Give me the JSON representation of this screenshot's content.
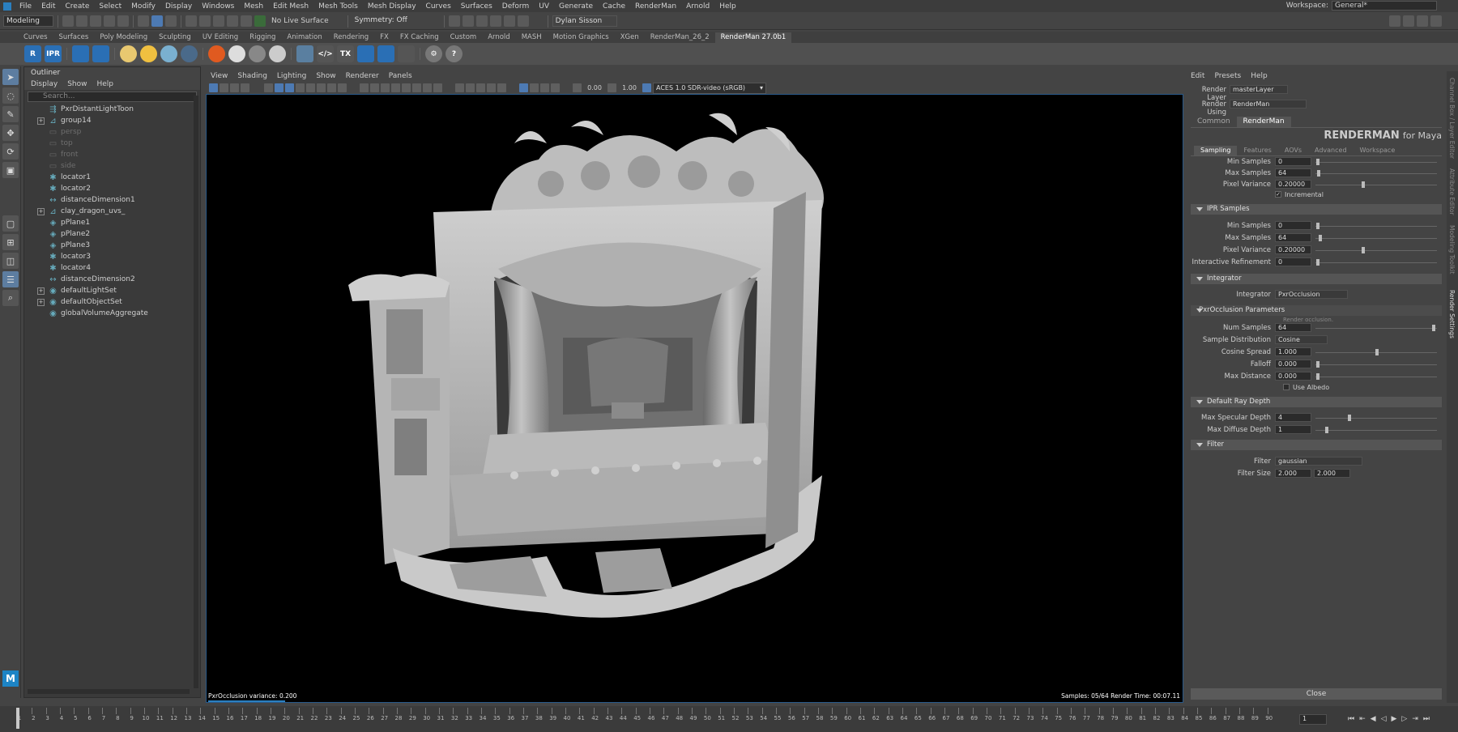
{
  "menubar": {
    "items": [
      "File",
      "Edit",
      "Create",
      "Select",
      "Modify",
      "Display",
      "Windows",
      "Mesh",
      "Edit Mesh",
      "Mesh Tools",
      "Mesh Display",
      "Curves",
      "Surfaces",
      "Deform",
      "UV",
      "Generate",
      "Cache",
      "RenderMan",
      "Arnold",
      "Help"
    ],
    "workspace_label": "Workspace:",
    "workspace_value": "General*"
  },
  "statusline": {
    "mode": "Modeling",
    "live_surface": "No Live Surface",
    "symmetry": "Symmetry: Off",
    "user": "Dylan Sisson"
  },
  "shelf_tabs": [
    "Curves",
    "Surfaces",
    "Poly Modeling",
    "Sculpting",
    "UV Editing",
    "Rigging",
    "Animation",
    "Rendering",
    "FX",
    "FX Caching",
    "Custom",
    "Arnold",
    "MASH",
    "Motion Graphics",
    "XGen",
    "RenderMan_26_2",
    "RenderMan 27.0b1"
  ],
  "shelf_active_tab": "RenderMan 27.0b1",
  "shelf_icons": [
    "R",
    "IPR",
    "TX"
  ],
  "outliner": {
    "title": "Outliner",
    "menu": [
      "Display",
      "Show",
      "Help"
    ],
    "search_placeholder": "Search...",
    "items": [
      {
        "label": "PxrDistantLightToon",
        "icon": "light-icon",
        "expand": false,
        "dim": false
      },
      {
        "label": "group14",
        "icon": "group-icon",
        "expand": true,
        "dim": false
      },
      {
        "label": "persp",
        "icon": "camera-icon",
        "expand": false,
        "dim": true
      },
      {
        "label": "top",
        "icon": "camera-icon",
        "expand": false,
        "dim": true
      },
      {
        "label": "front",
        "icon": "camera-icon",
        "expand": false,
        "dim": true
      },
      {
        "label": "side",
        "icon": "camera-icon",
        "expand": false,
        "dim": true
      },
      {
        "label": "locator1",
        "icon": "locator-icon",
        "expand": false,
        "dim": false
      },
      {
        "label": "locator2",
        "icon": "locator-icon",
        "expand": false,
        "dim": false
      },
      {
        "label": "distanceDimension1",
        "icon": "distance-icon",
        "expand": false,
        "dim": false
      },
      {
        "label": "clay_dragon_uvs_",
        "icon": "group-icon",
        "expand": true,
        "dim": false
      },
      {
        "label": "pPlane1",
        "icon": "mesh-icon",
        "expand": false,
        "dim": false
      },
      {
        "label": "pPlane2",
        "icon": "mesh-icon",
        "expand": false,
        "dim": false
      },
      {
        "label": "pPlane3",
        "icon": "mesh-icon",
        "expand": false,
        "dim": false
      },
      {
        "label": "locator3",
        "icon": "locator-icon",
        "expand": false,
        "dim": false
      },
      {
        "label": "locator4",
        "icon": "locator-icon",
        "expand": false,
        "dim": false
      },
      {
        "label": "distanceDimension2",
        "icon": "distance-icon",
        "expand": false,
        "dim": false
      },
      {
        "label": "defaultLightSet",
        "icon": "set-icon",
        "expand": true,
        "dim": false
      },
      {
        "label": "defaultObjectSet",
        "icon": "set-icon",
        "expand": true,
        "dim": false
      },
      {
        "label": "globalVolumeAggregate",
        "icon": "set-icon",
        "expand": false,
        "dim": false
      }
    ]
  },
  "viewport": {
    "menu": [
      "View",
      "Shading",
      "Lighting",
      "Show",
      "Renderer",
      "Panels"
    ],
    "exposure": "0.00",
    "gamma": "1.00",
    "color_space": "ACES 1.0 SDR-video (sRGB)",
    "status_left": "PxrOcclusion  variance: 0.200",
    "status_right": "Samples: 05/64  Render Time: 00:07.11"
  },
  "render_settings": {
    "menu": [
      "Edit",
      "Presets",
      "Help"
    ],
    "render_layer_label": "Render Layer",
    "render_layer": "masterLayer",
    "render_using_label": "Render Using",
    "render_using": "RenderMan",
    "tabs": [
      "Common",
      "RenderMan"
    ],
    "logo": "RENDERMAN",
    "logo_suffix": "for Maya",
    "subtabs": [
      "Sampling",
      "Features",
      "AOVs",
      "Advanced",
      "Workspace"
    ],
    "sampling": {
      "min_label": "Min Samples",
      "min": "0",
      "max_label": "Max Samples",
      "max": "64",
      "pv_label": "Pixel Variance",
      "pv": "0.20000",
      "incremental": "Incremental"
    },
    "ipr": {
      "title": "IPR Samples",
      "min_label": "Min Samples",
      "min": "0",
      "max_label": "Max Samples",
      "max": "64",
      "pv_label": "Pixel Variance",
      "pv": "0.20000",
      "ir_label": "Interactive Refinement",
      "ir": "0"
    },
    "integrator": {
      "title": "Integrator",
      "label": "Integrator",
      "value": "PxrOcclusion"
    },
    "occ": {
      "title": "PxrOcclusion Parameters",
      "hint": "Render occlusion.",
      "ns_label": "Num Samples",
      "ns": "64",
      "sd_label": "Sample Distribution",
      "sd": "Cosine",
      "cs_label": "Cosine Spread",
      "cs": "1.000",
      "fo_label": "Falloff",
      "fo": "0.000",
      "md_label": "Max Distance",
      "md": "0.000",
      "albedo": "Use Albedo"
    },
    "depth": {
      "title": "Default Ray Depth",
      "spec_label": "Max Specular Depth",
      "spec": "4",
      "diff_label": "Max Diffuse Depth",
      "diff": "1"
    },
    "filter": {
      "title": "Filter",
      "label": "Filter",
      "value": "gaussian",
      "size_label": "Filter Size",
      "size_x": "2.000",
      "size_y": "2.000"
    },
    "close": "Close"
  },
  "side_tabs": [
    "Channel Box / Layer Editor",
    "Attribute Editor",
    "Modeling Toolkit",
    "Render Settings"
  ],
  "timeline": {
    "ticks": [
      "1",
      "2",
      "3",
      "4",
      "5",
      "6",
      "7",
      "8",
      "9",
      "10",
      "11",
      "12",
      "13",
      "14",
      "15",
      "16",
      "17",
      "18",
      "19",
      "20",
      "21",
      "22",
      "23",
      "24",
      "25",
      "26",
      "27",
      "28",
      "29",
      "30",
      "31",
      "32",
      "33",
      "34",
      "35",
      "36",
      "37",
      "38",
      "39",
      "40",
      "41",
      "42",
      "43",
      "44",
      "45",
      "46",
      "47",
      "48",
      "49",
      "50",
      "51",
      "52",
      "53",
      "54",
      "55",
      "56",
      "57",
      "58",
      "59",
      "60",
      "61",
      "62",
      "63",
      "64",
      "65",
      "66",
      "67",
      "68",
      "69",
      "70",
      "71",
      "72",
      "73",
      "74",
      "75",
      "76",
      "77",
      "78",
      "79",
      "80",
      "81",
      "82",
      "83",
      "84",
      "85",
      "86",
      "87",
      "88",
      "89",
      "90"
    ],
    "current_frame": "1"
  },
  "colors": {
    "accent": "#4d7ab3",
    "viewport_bg": "#000000",
    "panel": "#444444"
  }
}
